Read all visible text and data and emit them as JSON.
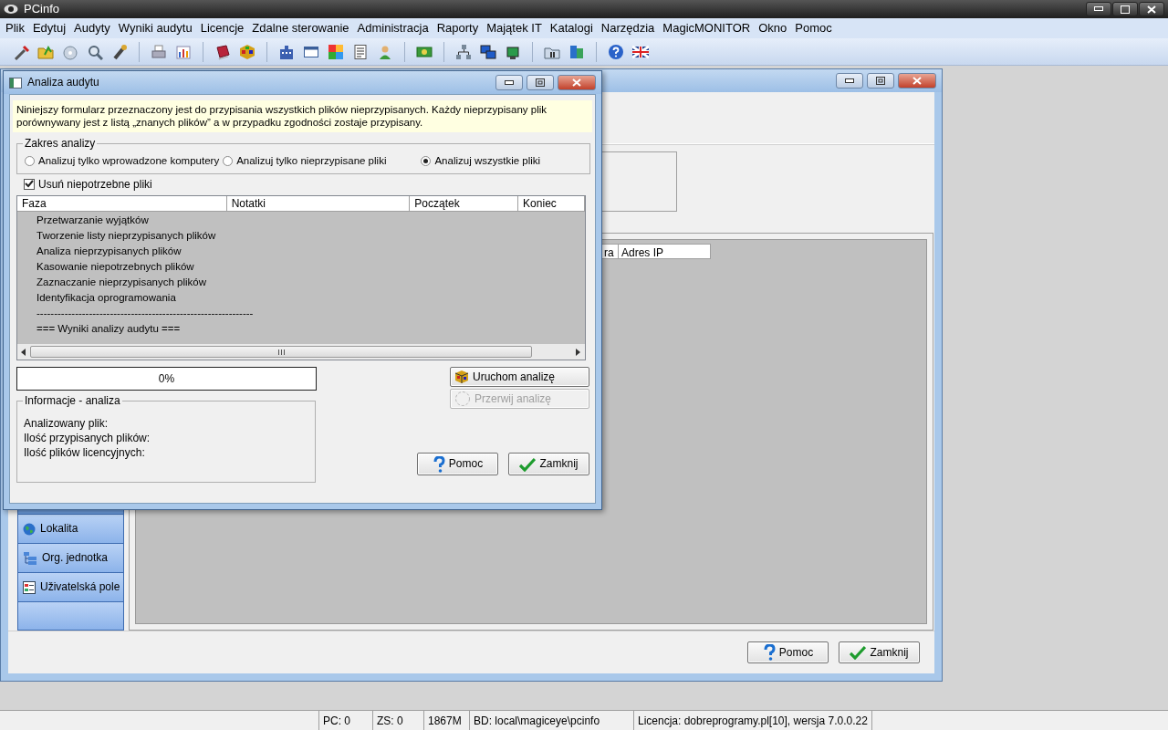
{
  "app": {
    "title": "PCinfo"
  },
  "menu": [
    {
      "label": "Plik"
    },
    {
      "label": "Edytuj"
    },
    {
      "label": "Audyty"
    },
    {
      "label": "Wyniki audytu"
    },
    {
      "label": "Licencje"
    },
    {
      "label": "Zdalne sterowanie"
    },
    {
      "label": "Administracja"
    },
    {
      "label": "Raporty"
    },
    {
      "label": "Majątek IT"
    },
    {
      "label": "Katalogi"
    },
    {
      "label": "Narzędzia"
    },
    {
      "label": "MagicMONITOR"
    },
    {
      "label": "Okno"
    },
    {
      "label": "Pomoc"
    }
  ],
  "background_window": {
    "list_columns": [
      "ra",
      "Adres IP"
    ],
    "sidebar_items": [
      {
        "label": "Lokalita",
        "kind": "globe"
      },
      {
        "label": "Org. jednotka",
        "kind": "tree"
      },
      {
        "label": "Uživatelská pole",
        "kind": "form"
      }
    ],
    "buttons": [
      {
        "label": "Pomoc",
        "kind": "help"
      },
      {
        "label": "Zamknij",
        "kind": "close"
      }
    ]
  },
  "dialog": {
    "title": "Analiza audytu",
    "info": "Niniejszy formularz przeznaczony jest do przypisania wszystkich plików nieprzypisanych. Każdy nieprzypisany plik porównywany jest z listą „znanych plików” a w przypadku zgodności zostaje przypisany.",
    "scope": {
      "legend": "Zakres analizy",
      "options": [
        {
          "label": "Analizuj tylko wprowadzone komputery",
          "selected": false
        },
        {
          "label": "Analizuj tylko nieprzypisane pliki",
          "selected": false
        },
        {
          "label": "Analizuj wszystkie pliki",
          "selected": true
        }
      ]
    },
    "delete_checkbox": {
      "label": "Usuń niepotrzebne pliki",
      "checked": true
    },
    "table": {
      "columns": [
        "Faza",
        "Notatki",
        "Początek",
        "Koniec"
      ],
      "rows": [
        "Przetwarzanie wyjątków",
        "Tworzenie listy nieprzypisanych plików",
        "Analiza nieprzypisanych plików",
        "Kasowanie niepotrzebnych plików",
        "Zaznaczanie nieprzypisanych plików",
        "Identyfikacja oprogramowania",
        "--------------------------------------------------------------",
        "=== Wyniki analizy audytu ==="
      ]
    },
    "progress": {
      "text": "0%",
      "level": 0
    },
    "action_buttons": [
      {
        "label": "Uruchom analizę",
        "kind": "run",
        "disabled": false
      },
      {
        "label": "Przerwij analizę",
        "kind": "stop",
        "disabled": true
      }
    ],
    "info_box": {
      "legend": "Informacje - analiza",
      "lines": [
        "Analizowany plik:",
        "Ilość przypisanych plików:",
        "Ilość plików licencyjnych:"
      ]
    },
    "buttons": [
      {
        "label": "Pomoc",
        "kind": "help"
      },
      {
        "label": "Zamknij",
        "kind": "close"
      }
    ]
  },
  "status_bar": [
    "PC: 0",
    "ZS: 0",
    "1867M",
    "BD: local\\magiceye\\pcinfo",
    "Licencja: dobreprogramy.pl[10], wersja 7.0.0.22"
  ]
}
